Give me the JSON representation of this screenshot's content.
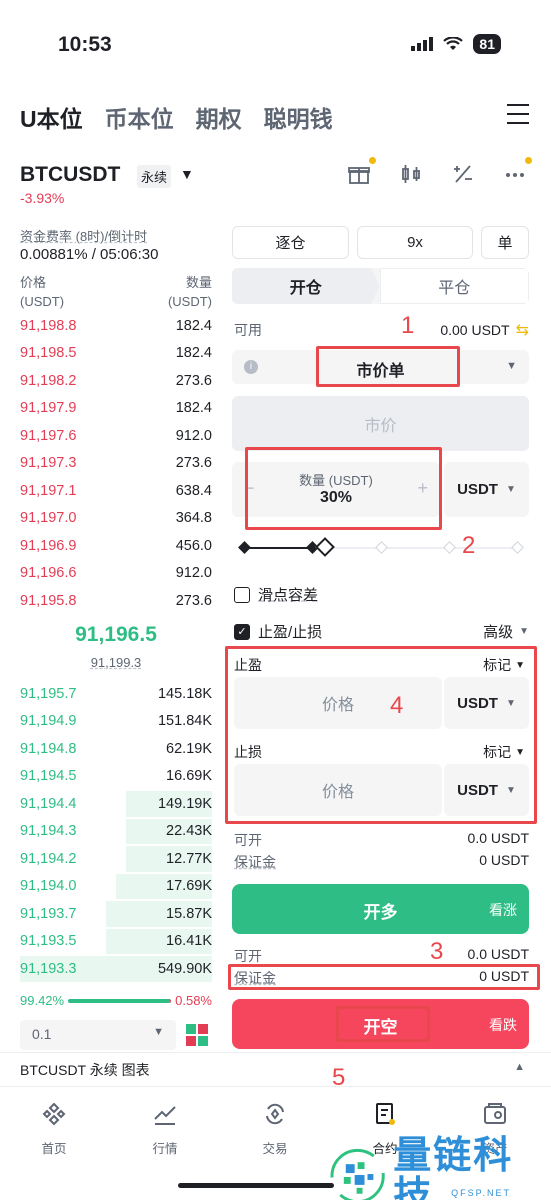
{
  "status_bar": {
    "time": "10:53",
    "battery": "81"
  },
  "nav_tabs": [
    "U本位",
    "币本位",
    "期权",
    "聪明钱"
  ],
  "symbol": {
    "name": "BTCUSDT",
    "type": "永续",
    "change": "-3.93%"
  },
  "funding": {
    "label": "资金费率 (8时)/倒计时",
    "value": "0.00881% / 05:06:30"
  },
  "orderbook": {
    "price_header": "价格",
    "qty_header": "数量",
    "unit": "(USDT)",
    "asks": [
      {
        "price": "91,198.8",
        "qty": "182.4"
      },
      {
        "price": "91,198.5",
        "qty": "182.4"
      },
      {
        "price": "91,198.2",
        "qty": "273.6"
      },
      {
        "price": "91,197.9",
        "qty": "182.4"
      },
      {
        "price": "91,197.6",
        "qty": "912.0"
      },
      {
        "price": "91,197.3",
        "qty": "273.6"
      },
      {
        "price": "91,197.1",
        "qty": "638.4"
      },
      {
        "price": "91,197.0",
        "qty": "364.8"
      },
      {
        "price": "91,196.9",
        "qty": "456.0"
      },
      {
        "price": "91,196.6",
        "qty": "912.0"
      },
      {
        "price": "91,195.8",
        "qty": "273.6"
      }
    ],
    "last_price": "91,196.5",
    "mark_price": "91,199.3",
    "bids": [
      {
        "price": "91,195.7",
        "qty": "145.18K",
        "depth": 0.0
      },
      {
        "price": "91,194.9",
        "qty": "151.84K",
        "depth": 0.0
      },
      {
        "price": "91,194.8",
        "qty": "62.19K",
        "depth": 0.0
      },
      {
        "price": "91,194.5",
        "qty": "16.69K",
        "depth": 0.0
      },
      {
        "price": "91,194.4",
        "qty": "149.19K",
        "depth": 0.45
      },
      {
        "price": "91,194.3",
        "qty": "22.43K",
        "depth": 0.45
      },
      {
        "price": "91,194.2",
        "qty": "12.77K",
        "depth": 0.45
      },
      {
        "price": "91,194.0",
        "qty": "17.69K",
        "depth": 0.5
      },
      {
        "price": "91,193.7",
        "qty": "15.87K",
        "depth": 0.55
      },
      {
        "price": "91,193.5",
        "qty": "16.41K",
        "depth": 0.55
      },
      {
        "price": "91,193.3",
        "qty": "549.90K",
        "depth": 1.0
      }
    ],
    "buy_ratio": "99.42%",
    "sell_ratio": "0.58%",
    "depth_step": "0.1"
  },
  "trade": {
    "margin_mode": "逐仓",
    "leverage": "9x",
    "position_mode": "单",
    "open_tab": "开仓",
    "close_tab": "平仓",
    "available_label": "可用",
    "available_value": "0.00 USDT",
    "order_type": "市价单",
    "market_placeholder": "市价",
    "amount_label": "数量 (USDT)",
    "amount_value": "30%",
    "amount_unit": "USDT",
    "amount_pct": 0.3,
    "slippage_label": "滑点容差",
    "tpsl_label": "止盈/止损",
    "advanced_label": "高级",
    "tp_label": "止盈",
    "sl_label": "止损",
    "mark_label": "标记",
    "price_placeholder": "价格",
    "price_unit": "USDT",
    "long_max_label": "可开",
    "long_max_value": "0.0 USDT",
    "long_margin_label": "保证金",
    "long_margin_value": "0 USDT",
    "long_button": "开多",
    "long_sub": "看涨",
    "short_max_label": "可开",
    "short_max_value": "0.0 USDT",
    "short_margin_label": "保证金",
    "short_margin_value": "0 USDT",
    "short_button": "开空",
    "short_sub": "看跌"
  },
  "annotations": [
    "1",
    "2",
    "3",
    "4",
    "5"
  ],
  "chart_bar": "BTCUSDT 永续  图表",
  "tabbar": [
    "首页",
    "行情",
    "交易",
    "合约",
    "资产"
  ],
  "watermark": {
    "text": "量链科技",
    "domain": "QFSP.NET"
  },
  "colors": {
    "up": "#2ebd85",
    "down": "#f6465d",
    "accent": "#f0b90b",
    "annotation": "#e8474b"
  }
}
